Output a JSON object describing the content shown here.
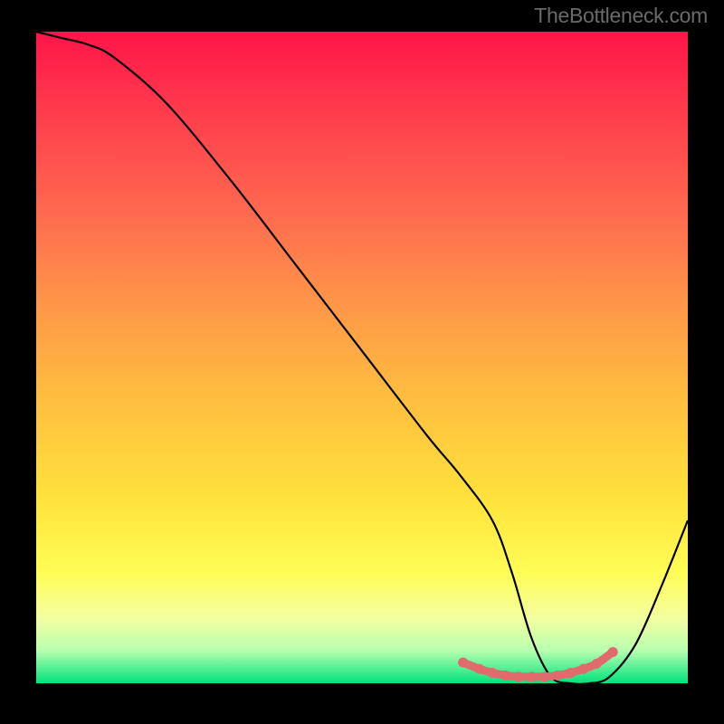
{
  "attribution": "TheBottleneck.com",
  "colors": {
    "curve_stroke": "#000000",
    "marker_fill": "#e06a6c",
    "marker_stroke": "#e06a6c",
    "gradient_top": "#ff1449",
    "gradient_bottom": "#00e27c",
    "background": "#000000"
  },
  "chart_data": {
    "type": "line",
    "title": "",
    "xlabel": "",
    "ylabel": "",
    "xlim": [
      0,
      100
    ],
    "ylim": [
      0,
      100
    ],
    "x": [
      0,
      4,
      8,
      12,
      20,
      30,
      40,
      50,
      60,
      65,
      70,
      73,
      76,
      79,
      82,
      85,
      88,
      92,
      96,
      100
    ],
    "values": [
      100,
      99,
      98,
      96,
      89,
      77,
      64,
      51,
      38,
      32,
      25,
      17,
      7,
      1,
      0,
      0,
      1,
      6,
      15,
      25
    ],
    "markers": {
      "x": [
        65.5,
        68,
        70,
        72,
        74,
        76,
        78,
        80,
        82,
        84,
        86,
        88.5
      ],
      "values": [
        3.2,
        2.2,
        1.6,
        1.2,
        1.0,
        1.0,
        1.0,
        1.2,
        1.6,
        2.2,
        3.0,
        4.8
      ]
    },
    "gradient_description": "vertical red-to-green spectral background"
  }
}
